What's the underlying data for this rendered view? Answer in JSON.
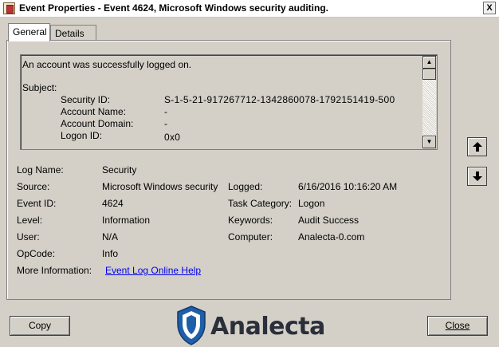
{
  "window": {
    "title": "Event Properties - Event 4624, Microsoft Windows security auditing.",
    "close_label": "X"
  },
  "tabs": [
    {
      "label": "General",
      "active": true
    },
    {
      "label": "Details",
      "active": false
    }
  ],
  "description": {
    "first_line": "An account was successfully logged on.",
    "section": "Subject:",
    "rows": [
      {
        "key": "Security ID:",
        "value": "S-1-5-21-917267712-1342860078-1792151419-500"
      },
      {
        "key": "Account Name:",
        "value": "-"
      },
      {
        "key": "Account Domain:",
        "value": "-"
      },
      {
        "key": "Logon ID:",
        "value": "0x0"
      }
    ]
  },
  "fields": {
    "log_name": {
      "label": "Log Name:",
      "value": "Security"
    },
    "source": {
      "label": "Source:",
      "value": "Microsoft Windows security"
    },
    "logged": {
      "label": "Logged:",
      "value": "6/16/2016 10:16:20 AM"
    },
    "event_id": {
      "label": "Event ID:",
      "value": "4624"
    },
    "task_category": {
      "label": "Task Category:",
      "value": "Logon"
    },
    "level": {
      "label": "Level:",
      "value": "Information"
    },
    "keywords": {
      "label": "Keywords:",
      "value": "Audit Success"
    },
    "user": {
      "label": "User:",
      "value": "N/A"
    },
    "computer": {
      "label": "Computer:",
      "value": "Analecta-0.com"
    },
    "opcode": {
      "label": "OpCode:",
      "value": "Info"
    },
    "more_info": {
      "label": "More Information:",
      "link": "Event Log Online Help"
    }
  },
  "buttons": {
    "copy": "Copy",
    "close": "Close"
  },
  "logo": {
    "text": "Analecta",
    "shield_color": "#1f5fa8"
  }
}
